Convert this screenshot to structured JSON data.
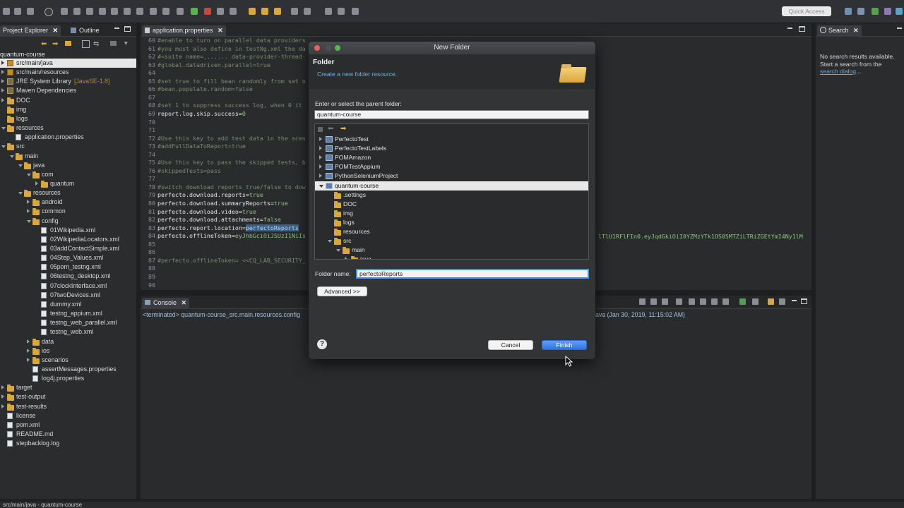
{
  "toolbar": {
    "quick_access": "Quick Access"
  },
  "project_explorer": {
    "tab_label": "Project Explorer",
    "outline_label": "Outline",
    "root": "quantum-course",
    "items": [
      {
        "label": "src/main/java",
        "level": 0,
        "kind": "pkgfolder",
        "open": false,
        "selected": true
      },
      {
        "label": "src/main/resources",
        "level": 0,
        "kind": "pkgfolder",
        "open": false
      },
      {
        "label": "JRE System Library",
        "suffix": "[JavaSE-1.8]",
        "level": 0,
        "kind": "lib",
        "open": false
      },
      {
        "label": "Maven Dependencies",
        "level": 0,
        "kind": "lib",
        "open": false
      },
      {
        "label": "DOC",
        "level": 0,
        "kind": "folder",
        "open": false
      },
      {
        "label": "img",
        "level": 0,
        "kind": "folder",
        "open": null
      },
      {
        "label": "logs",
        "level": 0,
        "kind": "folder",
        "open": null
      },
      {
        "label": "resources",
        "level": 0,
        "kind": "folder",
        "open": true
      },
      {
        "label": "application.properties",
        "level": 1,
        "kind": "file",
        "open": null
      },
      {
        "label": "src",
        "level": 0,
        "kind": "folder",
        "open": true
      },
      {
        "label": "main",
        "level": 1,
        "kind": "folder",
        "open": true
      },
      {
        "label": "java",
        "level": 2,
        "kind": "folder",
        "open": true
      },
      {
        "label": "com",
        "level": 3,
        "kind": "folder",
        "open": true
      },
      {
        "label": "quantum",
        "level": 4,
        "kind": "folder",
        "open": false
      },
      {
        "label": "resources",
        "level": 2,
        "kind": "folder",
        "open": true
      },
      {
        "label": "android",
        "level": 3,
        "kind": "folder",
        "open": false
      },
      {
        "label": "common",
        "level": 3,
        "kind": "folder",
        "open": false
      },
      {
        "label": "config",
        "level": 3,
        "kind": "folder",
        "open": true
      },
      {
        "label": "01Wikipedia.xml",
        "level": 4,
        "kind": "file",
        "open": null
      },
      {
        "label": "02WikipediaLocators.xml",
        "level": 4,
        "kind": "file",
        "open": null
      },
      {
        "label": "03addContactSimple.xml",
        "level": 4,
        "kind": "file",
        "open": null
      },
      {
        "label": "04Step_Values.xml",
        "level": 4,
        "kind": "file",
        "open": null
      },
      {
        "label": "05pom_testng.xml",
        "level": 4,
        "kind": "file",
        "open": null
      },
      {
        "label": "06testng_desktop.xml",
        "level": 4,
        "kind": "file",
        "open": null
      },
      {
        "label": "07clockInterface.xml",
        "level": 4,
        "kind": "file",
        "open": null
      },
      {
        "label": "07twoDevices.xml",
        "level": 4,
        "kind": "file",
        "open": null
      },
      {
        "label": "dummy.xml",
        "level": 4,
        "kind": "file",
        "open": null
      },
      {
        "label": "testng_appium.xml",
        "level": 4,
        "kind": "file",
        "open": null
      },
      {
        "label": "testng_web_parallel.xml",
        "level": 4,
        "kind": "file",
        "open": null
      },
      {
        "label": "testng_web.xml",
        "level": 4,
        "kind": "file",
        "open": null
      },
      {
        "label": "data",
        "level": 3,
        "kind": "folder",
        "open": false
      },
      {
        "label": "ios",
        "level": 3,
        "kind": "folder",
        "open": false
      },
      {
        "label": "scenarios",
        "level": 3,
        "kind": "folder",
        "open": false
      },
      {
        "label": "assertMessages.properties",
        "level": 3,
        "kind": "file",
        "open": null
      },
      {
        "label": "log4j.properties",
        "level": 3,
        "kind": "file",
        "open": null
      },
      {
        "label": "target",
        "level": 0,
        "kind": "folder",
        "open": false
      },
      {
        "label": "test-output",
        "level": 0,
        "kind": "folder",
        "open": false
      },
      {
        "label": "test-results",
        "level": 0,
        "kind": "folder",
        "open": false
      },
      {
        "label": "license",
        "level": 0,
        "kind": "file",
        "open": null
      },
      {
        "label": "pom.xml",
        "level": 0,
        "kind": "file",
        "open": null
      },
      {
        "label": "README.md",
        "level": 0,
        "kind": "file",
        "open": null
      },
      {
        "label": "stepbacklog.log",
        "level": 0,
        "kind": "file",
        "open": null
      }
    ]
  },
  "editor": {
    "tab_label": "application.properties",
    "lines": [
      {
        "n": "60",
        "type": "cm",
        "text": "#enable to turn on parallel data providers"
      },
      {
        "n": "61",
        "type": "cm",
        "text": "#you must also define in testNg.xml the da"
      },
      {
        "n": "62",
        "type": "cm",
        "text": "#<suite name=....... data-provider-thread-"
      },
      {
        "n": "63",
        "type": "cm",
        "text": "#global.datadriven.parallel=true"
      },
      {
        "n": "64",
        "type": "cm",
        "text": ""
      },
      {
        "n": "65",
        "type": "cm",
        "text": "#set true to fill bean randomly from set o"
      },
      {
        "n": "66",
        "type": "cm",
        "text": "#bean.populate.random=false"
      },
      {
        "n": "67",
        "type": "cm",
        "text": ""
      },
      {
        "n": "68",
        "type": "cm",
        "text": "#set 1 to suppress success log, when 0 it"
      },
      {
        "n": "69",
        "type": "kv",
        "key": "report.log.skip.success=",
        "value": "0"
      },
      {
        "n": "70",
        "type": "cm",
        "text": ""
      },
      {
        "n": "71",
        "type": "cm",
        "text": ""
      },
      {
        "n": "72",
        "type": "cm",
        "text": "#Use this key to add test data in the scen"
      },
      {
        "n": "73",
        "type": "cm",
        "text": "#addFullDataToReport=true"
      },
      {
        "n": "74",
        "type": "cm",
        "text": ""
      },
      {
        "n": "75",
        "type": "cm",
        "text": "#Use this key to pass the skipped tests, b"
      },
      {
        "n": "76",
        "type": "cm",
        "text": "#skippedTests=pass"
      },
      {
        "n": "77",
        "type": "cm",
        "text": ""
      },
      {
        "n": "78",
        "type": "cm",
        "text": "#switch download reports true/false to dow"
      },
      {
        "n": "79",
        "type": "kv",
        "key": "perfecto.download.reports=",
        "value": "true"
      },
      {
        "n": "80",
        "type": "kv",
        "key": "perfecto.download.summaryReports=",
        "value": "true"
      },
      {
        "n": "81",
        "type": "kv",
        "key": "perfecto.download.video=",
        "value": "true"
      },
      {
        "n": "82",
        "type": "kv",
        "key": "perfecto.download.attachments=",
        "value": "false"
      },
      {
        "n": "83",
        "type": "kv",
        "key": "perfecto.report.location=",
        "value": "perfectoReports",
        "highlight": true
      },
      {
        "n": "84",
        "type": "kv",
        "key": "perfecto.offlineToken=",
        "value": "eyJhbGciOiJSUzI1NiIs"
      },
      {
        "n": "85",
        "type": "cm",
        "text": ""
      },
      {
        "n": "86",
        "type": "cm",
        "text": ""
      },
      {
        "n": "87",
        "type": "cm",
        "text": "#perfecto.offlineToken= <<CQ_LAB_SECURITY_"
      },
      {
        "n": "88",
        "type": "cm",
        "text": ""
      },
      {
        "n": "89",
        "type": "cm",
        "text": ""
      },
      {
        "n": "90",
        "type": "cm",
        "text": ""
      }
    ],
    "token_overflow": "lTlU1RFlFIn0.eyJqdGkiOiI0YZMzYTk1OS05MTZiLTRiZGEtYmI4Ny1lM"
  },
  "search": {
    "tab_label": "Search",
    "no_results": "No search results available.",
    "start_text": "Start a search from the",
    "link": "search dialog",
    "link_suffix": "..."
  },
  "console": {
    "tab_label": "Console",
    "left_text": "<terminated> quantum-course_src.main.resources.config",
    "right_text": "ava (Jan 30, 2019, 11:15:02 AM)"
  },
  "dialog": {
    "window_title": "New Folder",
    "heading": "Folder",
    "description": "Create a new folder resource.",
    "parent_label": "Enter or select the parent folder:",
    "parent_value": "quantum-course",
    "tree": [
      {
        "label": "PerfectoTest",
        "level": 0,
        "kind": "project",
        "open": false
      },
      {
        "label": "PerfectoTestLabels",
        "level": 0,
        "kind": "project",
        "open": false
      },
      {
        "label": "POMAmazon",
        "level": 0,
        "kind": "project",
        "open": false
      },
      {
        "label": "POMTestAppium",
        "level": 0,
        "kind": "project",
        "open": false
      },
      {
        "label": "PythonSeleniumProject",
        "level": 0,
        "kind": "project",
        "open": false
      },
      {
        "label": "quantum-course",
        "level": 0,
        "kind": "project",
        "open": true,
        "selected": true
      },
      {
        "label": ".settings",
        "level": 1,
        "kind": "folder",
        "open": null
      },
      {
        "label": "DOC",
        "level": 1,
        "kind": "folder",
        "open": null
      },
      {
        "label": "img",
        "level": 1,
        "kind": "folder",
        "open": null
      },
      {
        "label": "logs",
        "level": 1,
        "kind": "folder",
        "open": null
      },
      {
        "label": "resources",
        "level": 1,
        "kind": "folder",
        "open": null
      },
      {
        "label": "src",
        "level": 1,
        "kind": "folder",
        "open": true
      },
      {
        "label": "main",
        "level": 2,
        "kind": "folder",
        "open": true
      },
      {
        "label": "java",
        "level": 3,
        "kind": "folder",
        "open": false
      }
    ],
    "folder_name_label": "Folder name:",
    "folder_name_value": "perfectoReports",
    "advanced_label": "Advanced >>",
    "cancel_label": "Cancel",
    "finish_label": "Finish"
  },
  "status": {
    "text": "src/main/java - quantum-course"
  }
}
